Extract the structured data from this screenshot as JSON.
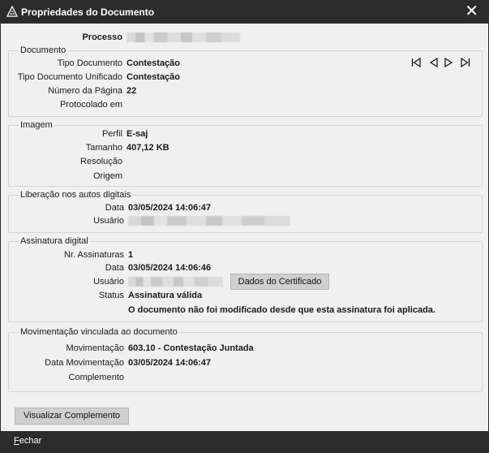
{
  "window": {
    "title": "Propriedades do Documento",
    "close_glyph": "✕"
  },
  "processo": {
    "label": "Processo"
  },
  "documento": {
    "title": "Documento",
    "tipo_label": "Tipo Documento",
    "tipo_value": "Contestação",
    "tipo_unificado_label": "Tipo Documento Unificado",
    "tipo_unificado_value": "Contestação",
    "numero_pagina_label": "Número da Página",
    "numero_pagina_value": "22",
    "protocolado_label": "Protocolado em",
    "protocolado_value": ""
  },
  "imagem": {
    "title": "Imagem",
    "perfil_label": "Perfil",
    "perfil_value": "E-saj",
    "tamanho_label": "Tamanho",
    "tamanho_value": "407,12 KB",
    "resolucao_label": "Resolução",
    "resolucao_value": "",
    "origem_label": "Origem",
    "origem_value": ""
  },
  "liberacao": {
    "title": "Liberação nos autos digitais",
    "data_label": "Data",
    "data_value": "03/05/2024 14:06:47",
    "usuario_label": "Usuário"
  },
  "assinatura": {
    "title": "Assinatura digital",
    "nr_label": "Nr. Assinaturas",
    "nr_value": "1",
    "data_label": "Data",
    "data_value": "03/05/2024 14:06:46",
    "usuario_label": "Usuário",
    "certificado_button": "Dados do Certificado",
    "status_label": "Status",
    "status_value": "Assinatura válida",
    "status_message": "O documento não foi modificado desde que esta assinatura foi aplicada."
  },
  "movimentacao": {
    "title": "Movimentação vinculada ao documento",
    "mov_label": "Movimentação",
    "mov_value": "603.10 - Contestação Juntada",
    "data_label": "Data Movimentação",
    "data_value": "03/05/2024 14:06:47",
    "complemento_label": "Complemento",
    "complemento_value": ""
  },
  "buttons": {
    "visualizar_complemento": "Visualizar Complemento"
  },
  "footer": {
    "fechar_first": "F",
    "fechar_rest": "echar"
  },
  "icons": {
    "nav_first": "nav-first-icon",
    "nav_prev": "nav-prev-icon",
    "nav_next": "nav-next-icon",
    "nav_last": "nav-last-icon"
  }
}
